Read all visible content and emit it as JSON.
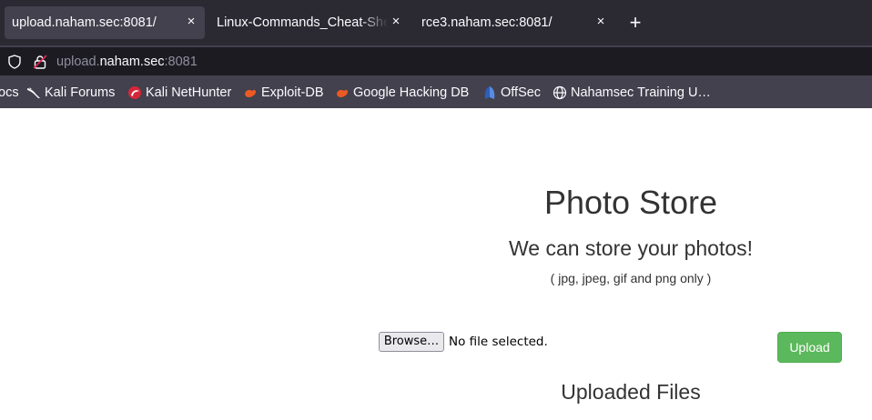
{
  "tabs": [
    {
      "title": "upload.naham.sec:8081/",
      "active": true,
      "close": "×"
    },
    {
      "title": "Linux-Commands_Cheat-Sheet",
      "active": false,
      "close": "×"
    },
    {
      "title": "rce3.naham.sec:8081/",
      "active": false,
      "close": "×"
    }
  ],
  "new_tab": "+",
  "url": {
    "prefix": "upload.",
    "host": "naham.sec",
    "port": ":8081"
  },
  "bookmarks": [
    {
      "label": "ocs",
      "icon": "none"
    },
    {
      "label": "Kali Forums",
      "icon": "kali-dragon-icon"
    },
    {
      "label": "Kali NetHunter",
      "icon": "nethunter-icon"
    },
    {
      "label": "Exploit-DB",
      "icon": "exploitdb-icon"
    },
    {
      "label": "Google Hacking DB",
      "icon": "ghdb-icon"
    },
    {
      "label": "OffSec",
      "icon": "offsec-icon"
    },
    {
      "label": "Nahamsec Training U…",
      "icon": "globe-icon"
    }
  ],
  "page": {
    "title": "Photo Store",
    "subtitle": "We can store your photos!",
    "note": "( jpg, jpeg, gif and png only )",
    "browse_label": "Browse…",
    "file_status": "No file selected.",
    "upload_label": "Upload",
    "files_heading": "Uploaded Files"
  },
  "colors": {
    "upload_button": "#5cb85c",
    "tabbar": "#2b2a33",
    "toolbar": "#42414d"
  }
}
